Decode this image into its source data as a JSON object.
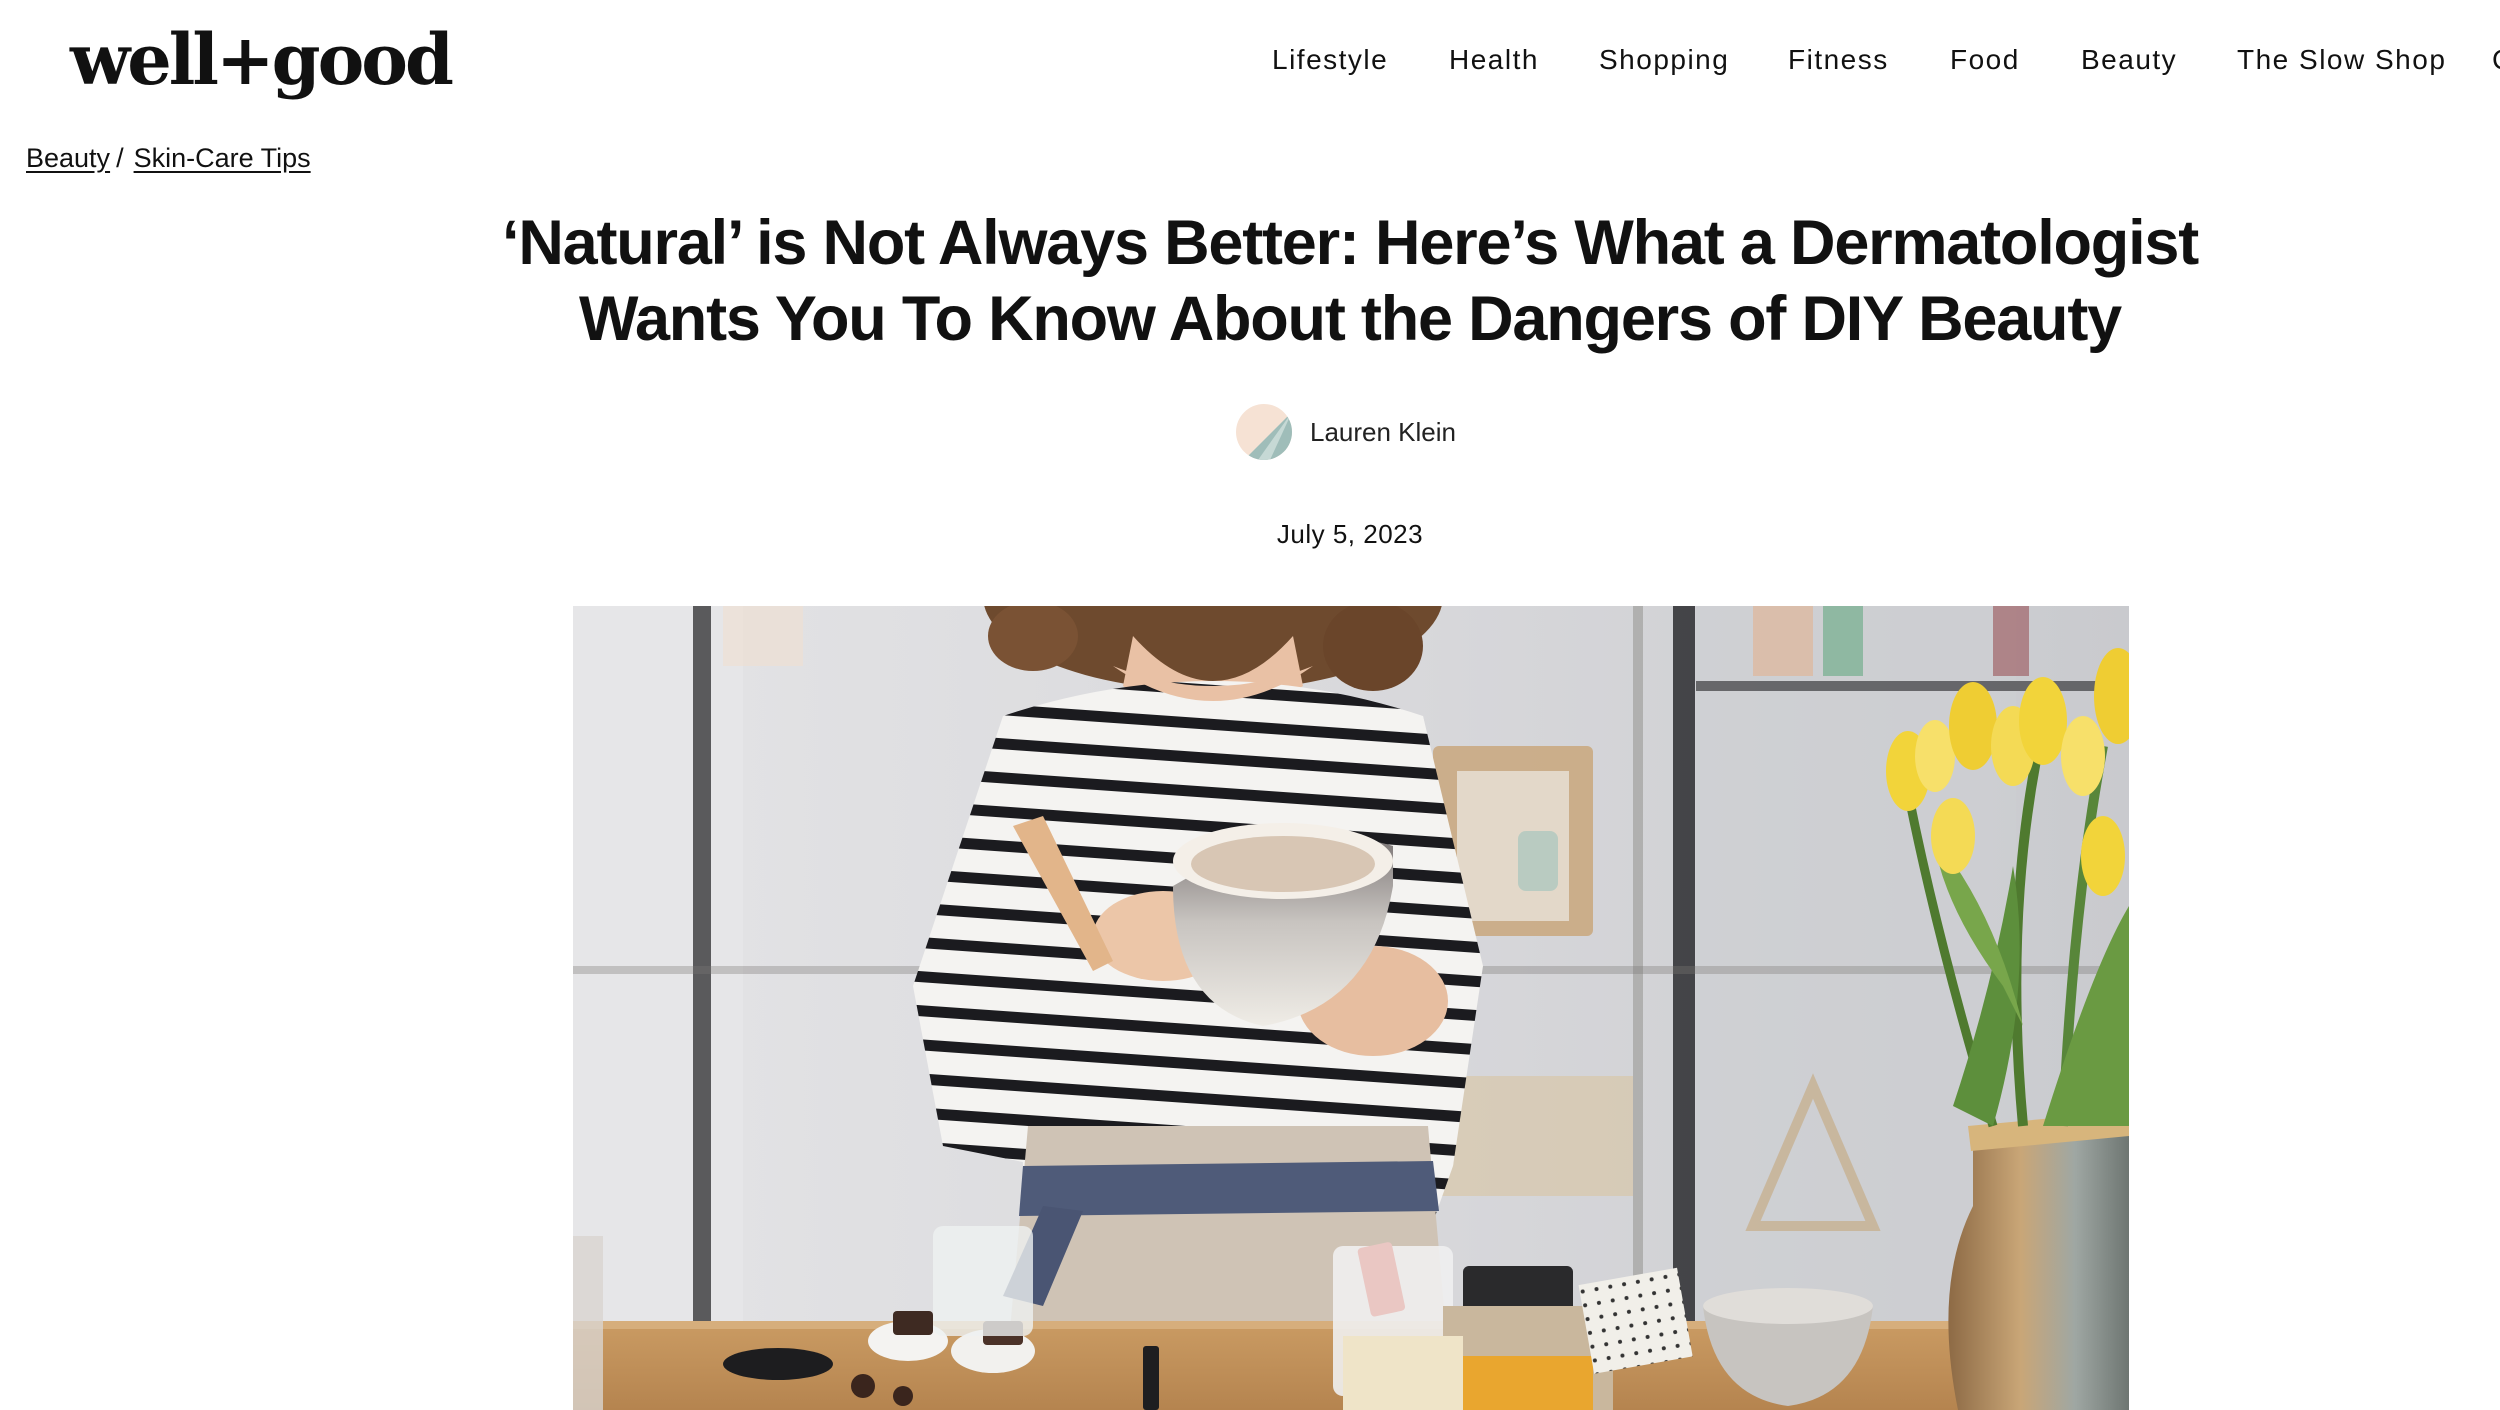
{
  "site": {
    "logo_text": "well+good"
  },
  "nav": {
    "items": [
      {
        "label": "Lifestyle"
      },
      {
        "label": "Health"
      },
      {
        "label": "Shopping"
      },
      {
        "label": "Fitness"
      },
      {
        "label": "Food"
      },
      {
        "label": "Beauty"
      },
      {
        "label": "The Slow Shop"
      }
    ],
    "overflow_text": "C"
  },
  "breadcrumb": {
    "items": [
      {
        "label": "Beauty"
      },
      {
        "label": "Skin-Care Tips"
      }
    ],
    "separator": "/"
  },
  "article": {
    "title_line1": "‘Natural’ is Not Always Better: Here’s What a Dermatologist",
    "title_line2": "Wants You To Know About the Dangers of DIY Beauty",
    "author": "Lauren Klein",
    "date": "July 5, 2023"
  },
  "hero_image": {
    "icon": "photo-woman-mixing-diy-skincare-bowl"
  },
  "colors": {
    "text": "#111111",
    "background": "#ffffff",
    "tulip_yellow": "#f2d43a",
    "apron": "#cfc3b5",
    "apron_belt": "#4f5b79"
  }
}
